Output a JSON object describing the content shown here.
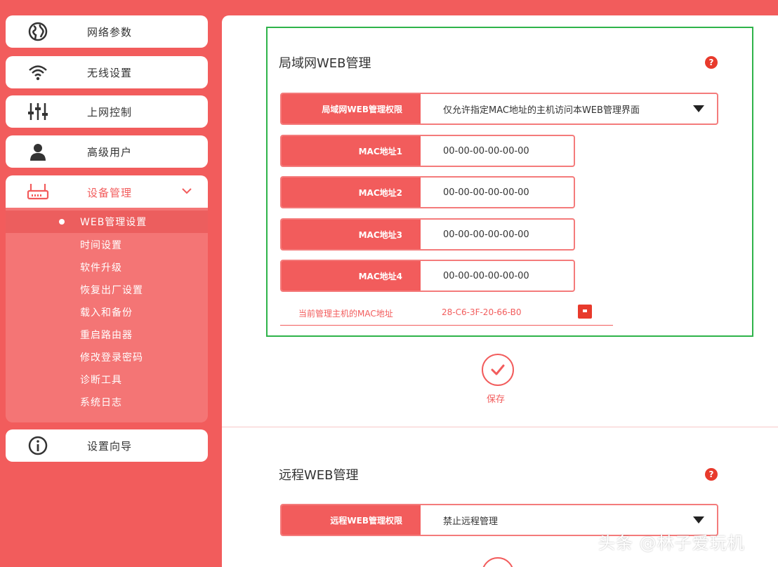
{
  "sidebar": {
    "items": [
      {
        "label": "网络参数",
        "icon": "globe-icon"
      },
      {
        "label": "无线设置",
        "icon": "wifi-icon"
      },
      {
        "label": "上网控制",
        "icon": "sliders-icon"
      },
      {
        "label": "高级用户",
        "icon": "user-icon"
      },
      {
        "label": "设备管理",
        "icon": "router-icon"
      },
      {
        "label": "设置向导",
        "icon": "info-icon"
      }
    ],
    "submenu": [
      "WEB管理设置",
      "时间设置",
      "软件升级",
      "恢复出厂设置",
      "载入和备份",
      "重启路由器",
      "修改登录密码",
      "诊断工具",
      "系统日志"
    ]
  },
  "lan_section": {
    "title": "局域网WEB管理",
    "help": "?",
    "access_label": "局域网WEB管理权限",
    "access_value": "仅允许指定MAC地址的主机访问本WEB管理界面",
    "mac_fields": [
      {
        "label": "MAC地址1",
        "value": "00-00-00-00-00-00"
      },
      {
        "label": "MAC地址2",
        "value": "00-00-00-00-00-00"
      },
      {
        "label": "MAC地址3",
        "value": "00-00-00-00-00-00"
      },
      {
        "label": "MAC地址4",
        "value": "00-00-00-00-00-00"
      }
    ],
    "current_label": "当前管理主机的MAC地址",
    "current_value": "28-C6-3F-20-66-B0",
    "save_label": "保存"
  },
  "remote_section": {
    "title": "远程WEB管理",
    "help": "?",
    "access_label": "远程WEB管理权限",
    "access_value": "禁止远程管理"
  },
  "watermark": "头条 @林子爱玩机",
  "colors": {
    "accent": "#f25c5c",
    "highlight": "#2eb34a"
  }
}
